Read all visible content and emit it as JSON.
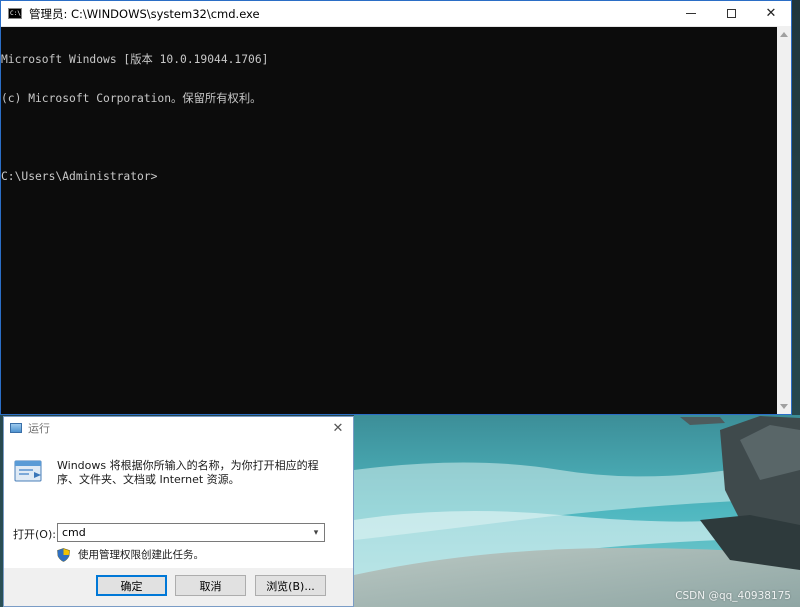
{
  "cmd_window": {
    "title": "管理员: C:\\WINDOWS\\system32\\cmd.exe",
    "icon": "cmd-icon",
    "controls": {
      "minimize": "—",
      "maximize": "",
      "close": "✕"
    },
    "lines": [
      "Microsoft Windows [版本 10.0.19044.1706]",
      "(c) Microsoft Corporation。保留所有权利。",
      "",
      "C:\\Users\\Administrator>"
    ]
  },
  "run_dialog": {
    "title": "运行",
    "close": "✕",
    "description": "Windows 将根据你所输入的名称，为你打开相应的程序、文件夹、文档或 Internet 资源。",
    "open_label": "打开(O):",
    "input_value": "cmd",
    "admin_note": "使用管理权限创建此任务。",
    "buttons": {
      "ok": "确定",
      "cancel": "取消",
      "browse": "浏览(B)..."
    }
  },
  "desktop": {
    "wallpaper": "beach-scene",
    "watermark": "CSDN @qq_40938175"
  },
  "colors": {
    "console_bg": "#0c0c0c",
    "console_text": "#c8c8c8",
    "accent": "#0078d7"
  }
}
